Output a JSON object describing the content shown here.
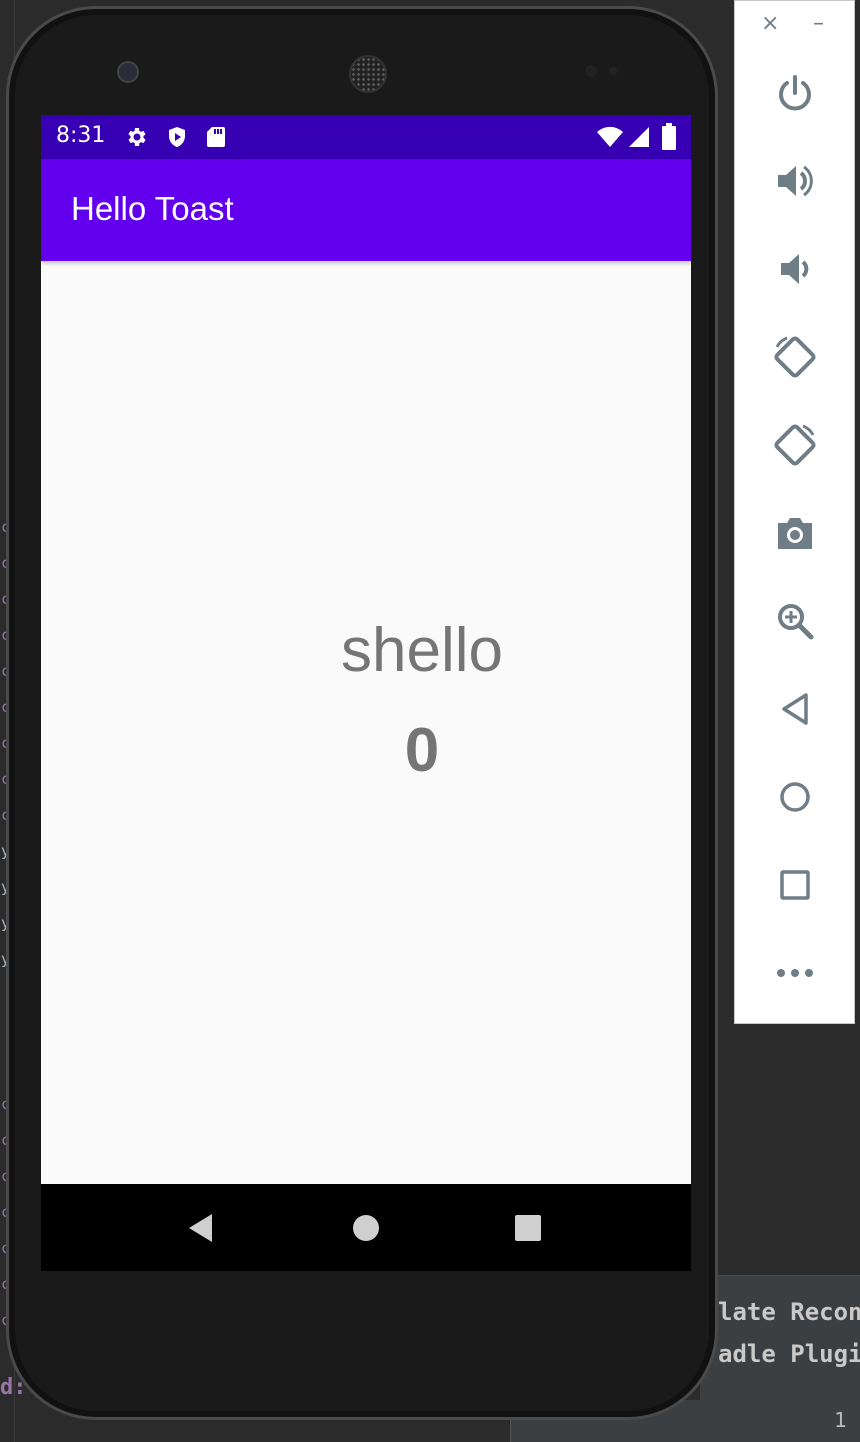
{
  "device": {
    "status_bar": {
      "time": "8:31"
    },
    "app_bar": {
      "title": "Hello Toast"
    },
    "content": {
      "greeting": "shello",
      "count": "0"
    }
  },
  "emulator_panel": {
    "window_controls": [
      "×",
      "–"
    ],
    "buttons": [
      "power-icon",
      "volume-up-icon",
      "volume-down-icon",
      "rotate-left-icon",
      "rotate-right-icon",
      "camera-icon",
      "zoom-icon",
      "back-icon",
      "home-icon",
      "overview-icon",
      "more-icon"
    ]
  },
  "ide": {
    "bottom_lines": [
      "late Recon",
      "adle Plugin"
    ],
    "status_number": "1",
    "bottom_left_text": "d:"
  },
  "colors": {
    "status_bar": "#3700b3",
    "app_bar": "#6200ee",
    "screen_bg": "#fafafa",
    "text_gray": "#757575",
    "panel_icon": "#6f7d87"
  }
}
